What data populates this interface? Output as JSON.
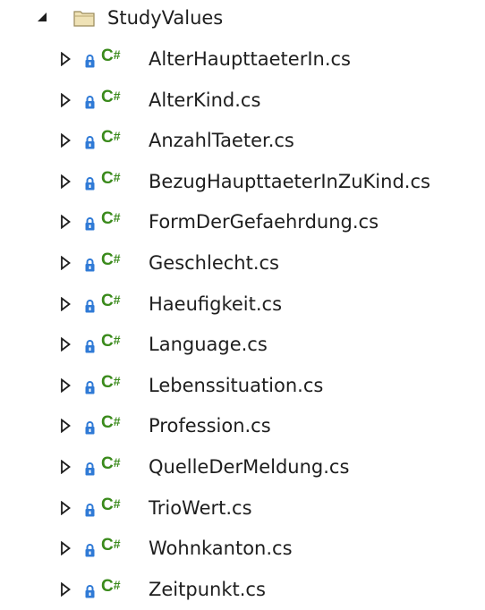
{
  "tree": {
    "folder": {
      "label": "StudyValues",
      "icon": "folder-icon",
      "expander_state": "expanded"
    },
    "file_icon": "csharp-file-icon",
    "file_icon_text": "C#",
    "lock_icon": "lock-icon",
    "files": [
      {
        "label": "AlterHaupttaeterIn.cs"
      },
      {
        "label": "AlterKind.cs"
      },
      {
        "label": "AnzahlTaeter.cs"
      },
      {
        "label": "BezugHaupttaeterInZuKind.cs"
      },
      {
        "label": "FormDerGefaehrdung.cs"
      },
      {
        "label": "Geschlecht.cs"
      },
      {
        "label": "Haeufigkeit.cs"
      },
      {
        "label": "Language.cs"
      },
      {
        "label": "Lebenssituation.cs"
      },
      {
        "label": "Profession.cs"
      },
      {
        "label": "QuelleDerMeldung.cs"
      },
      {
        "label": "TrioWert.cs"
      },
      {
        "label": "Wohnkanton.cs"
      },
      {
        "label": "Zeitpunkt.cs"
      }
    ],
    "colors": {
      "csharp_green": "#3a8a1b",
      "lock_blue": "#2f7ad6",
      "folder_fill": "#e8d8a8",
      "text": "#1e1e1e"
    }
  }
}
